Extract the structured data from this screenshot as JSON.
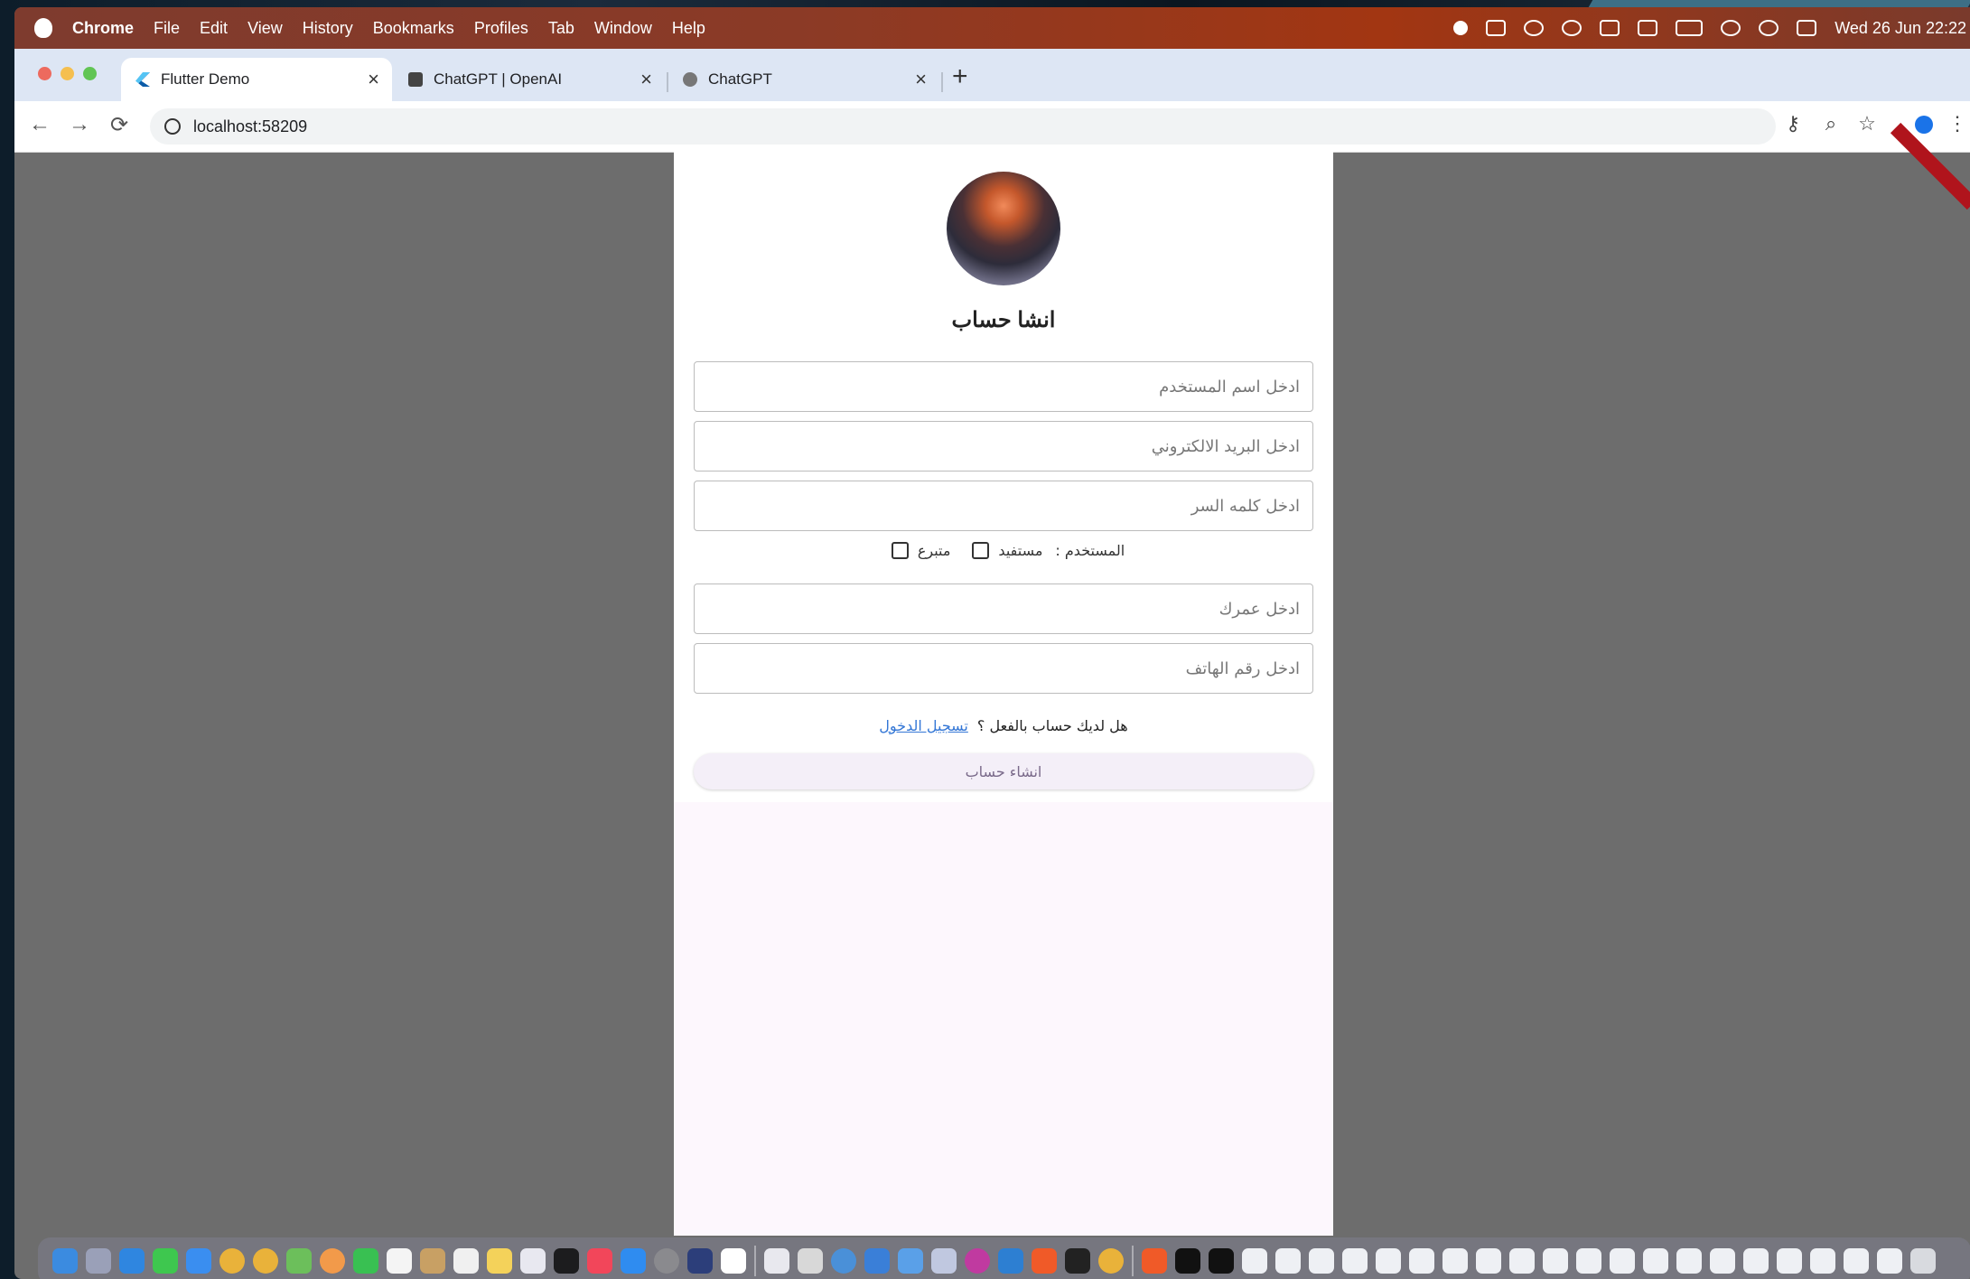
{
  "menubar": {
    "app": "Chrome",
    "menus": [
      "File",
      "Edit",
      "View",
      "History",
      "Bookmarks",
      "Profiles",
      "Tab",
      "Window",
      "Help"
    ],
    "clock": "Wed 26 Jun  22:22"
  },
  "tabs": [
    {
      "title": "Flutter Demo",
      "favicon": "flutter-icon",
      "close": "×"
    },
    {
      "title": "ChatGPT | OpenAI",
      "favicon": "openai-icon",
      "close": "×"
    },
    {
      "title": "ChatGPT",
      "favicon": "chatgpt-icon",
      "close": "×"
    }
  ],
  "new_tab": "+",
  "toolbar": {
    "back": "←",
    "forward": "→",
    "reload": "⟳",
    "url": "localhost:58209"
  },
  "form": {
    "title": "انشا حساب",
    "username_placeholder": "ادخل اسم المستخدم",
    "email_placeholder": "ادخل البريد الالكتروني",
    "password_placeholder": "ادخل كلمه السر",
    "user_type_label": "المستخدم :",
    "option_beneficiary": "مستفيد",
    "option_donor": "متبرع",
    "age_placeholder": "ادخل عمرك",
    "phone_placeholder": "ادخل رقم الهاتف",
    "have_account": "هل لديك حساب بالفعل ؟",
    "login_link": "تسجيل الدخول",
    "submit": "انشاء حساب"
  },
  "colors": {
    "menubar": "#8b3a26",
    "tabstrip": "#dde6f4",
    "link": "#3477d6",
    "page_bg": "#fdf7fd",
    "outside_bg": "#6d6d6d"
  }
}
